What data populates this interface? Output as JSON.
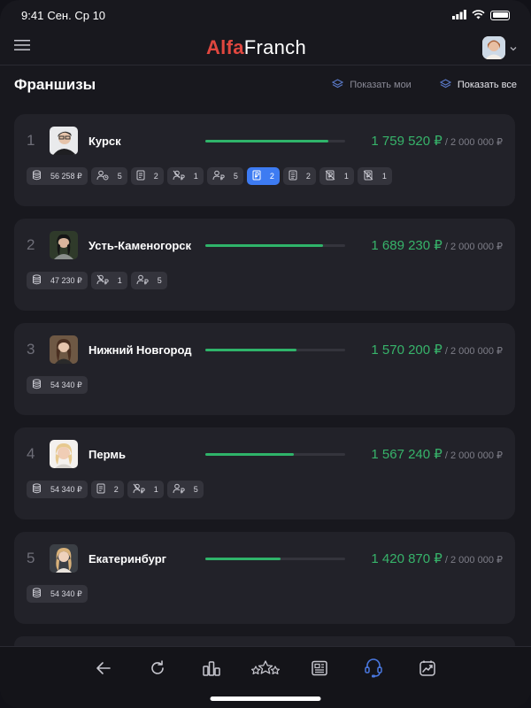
{
  "status_bar": {
    "time": "9:41",
    "date": "Сен. Ср 10"
  },
  "header": {
    "logo_alfa": "Alfa",
    "logo_franch": "Franch"
  },
  "title_row": {
    "title": "Франшизы",
    "filter_mine": "Показать мои",
    "filter_all": "Показать все"
  },
  "franchises": [
    {
      "rank": "1",
      "city": "Курск",
      "amount": "1 759 520 ₽",
      "goal": " / 2 000 000 ₽",
      "progress": 0.88,
      "tags": [
        {
          "icon": "coins-icon",
          "value": "56 258 ₽"
        },
        {
          "icon": "user-clock-icon",
          "value": "5"
        },
        {
          "icon": "document-icon",
          "value": "2"
        },
        {
          "icon": "user-ruble-off-icon",
          "value": "1"
        },
        {
          "icon": "user-ruble-icon",
          "value": "5"
        },
        {
          "icon": "receipt-icon",
          "value": "2"
        },
        {
          "icon": "document-lines-icon",
          "value": "2"
        },
        {
          "icon": "receipt-off-icon",
          "value": "1"
        },
        {
          "icon": "receipt-off-icon",
          "value": "1"
        }
      ]
    },
    {
      "rank": "2",
      "city": "Усть-Каменогорск",
      "amount": "1 689 230 ₽",
      "goal": " / 2 000 000 ₽",
      "progress": 0.84,
      "tags": [
        {
          "icon": "coins-icon",
          "value": "47 230 ₽"
        },
        {
          "icon": "user-ruble-off-icon",
          "value": "1"
        },
        {
          "icon": "user-ruble-icon",
          "value": "5"
        }
      ]
    },
    {
      "rank": "3",
      "city": "Нижний Новгород",
      "amount": "1 570 200 ₽",
      "goal": " / 2 000 000 ₽",
      "progress": 0.65,
      "tags": [
        {
          "icon": "coins-icon",
          "value": "54 340 ₽"
        }
      ]
    },
    {
      "rank": "4",
      "city": "Пермь",
      "amount": "1 567 240 ₽",
      "goal": " / 2 000 000 ₽",
      "progress": 0.63,
      "tags": [
        {
          "icon": "coins-icon",
          "value": "54 340 ₽"
        },
        {
          "icon": "document-icon",
          "value": "2"
        },
        {
          "icon": "user-ruble-off-icon",
          "value": "1"
        },
        {
          "icon": "user-ruble-icon",
          "value": "5"
        }
      ]
    },
    {
      "rank": "5",
      "city": "Екатеринбург",
      "amount": "1 420 870 ₽",
      "goal": " / 2 000 000 ₽",
      "progress": 0.54,
      "tags": [
        {
          "icon": "coins-icon",
          "value": "54 340 ₽"
        }
      ]
    }
  ],
  "nav": [
    "back-arrow-icon",
    "refresh-icon",
    "chart-bars-icon",
    "stars-icon",
    "newspaper-icon",
    "headset-icon",
    "trend-chart-icon"
  ],
  "colors": {
    "accent_green": "#37b36a",
    "accent_blue": "#3d7bf2",
    "brand_red": "#e0473f"
  }
}
